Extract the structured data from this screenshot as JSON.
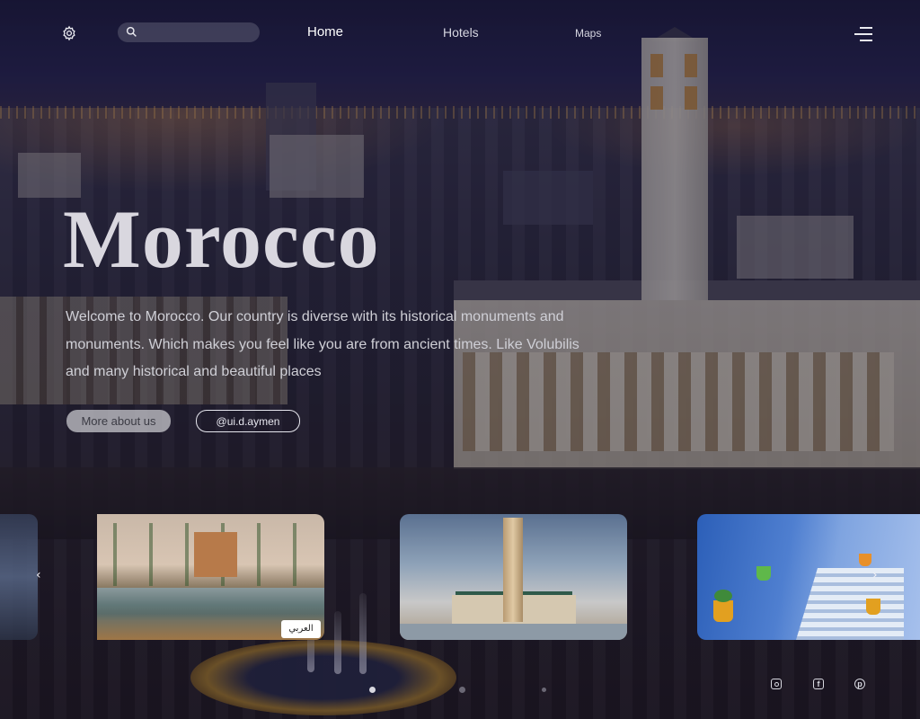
{
  "nav": {
    "search": {
      "placeholder": "",
      "value": ""
    },
    "links": [
      {
        "label": "Home",
        "active": true
      },
      {
        "label": "Hotels",
        "active": false
      },
      {
        "label": "Maps",
        "active": false
      }
    ],
    "icons": {
      "settings": "gear-icon",
      "search": "search-icon",
      "menu": "hamburger-menu-icon"
    }
  },
  "hero": {
    "title": "Morocco",
    "lines": [
      "Welcome to Morocco. Our country is diverse with its historical monuments and",
      "monuments. Which makes you feel like you are from ancient times. Like Volubilis",
      "and many historical and beautiful places"
    ],
    "primary_button": "More about us",
    "secondary_button": "@ui.d.aymen"
  },
  "carousel": {
    "prev_arrow": "‹",
    "next_arrow": "›",
    "card_logo_text": "العربي",
    "slides": [
      "garden-palace-pool",
      "hassan-ii-mosque",
      "blue-city-stairs"
    ],
    "active_dot": 0,
    "dot_count": 3
  },
  "social": {
    "icons": [
      "instagram-icon",
      "facebook-icon",
      "pinterest-icon"
    ],
    "facebook_glyph": "f",
    "pinterest_glyph": "p"
  },
  "colors": {
    "overlay": "#100e26",
    "text": "#e9e9ee",
    "primary_button_bg": "#c8c8cd"
  }
}
